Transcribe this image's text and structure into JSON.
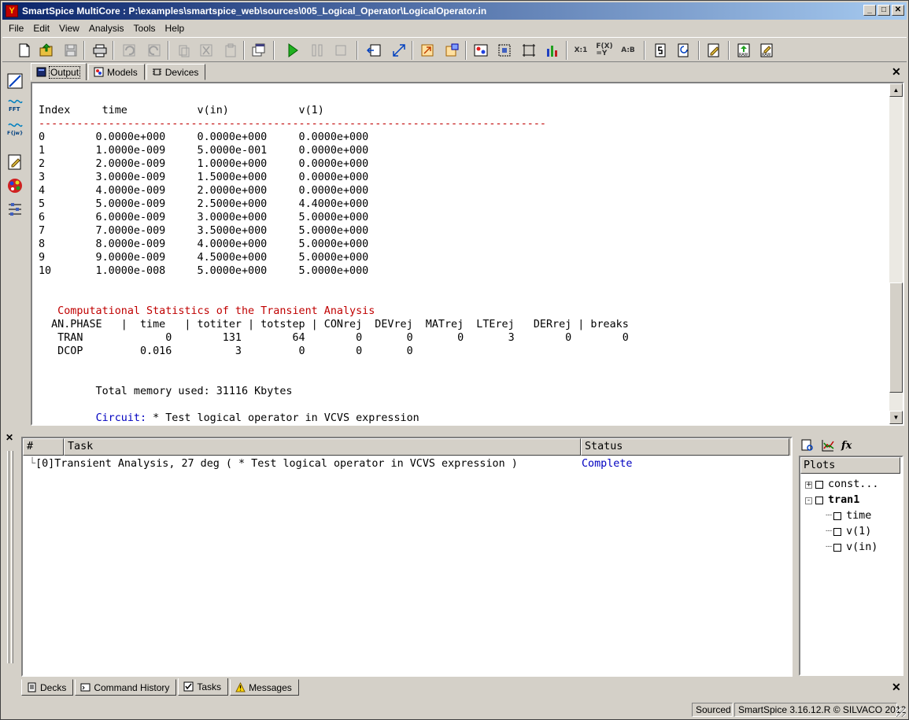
{
  "window": {
    "title": "SmartSpice MultiCore : P:\\examples\\smartspice_web\\sources\\005_Logical_Operator\\LogicalOperator.in",
    "app_icon_glyph": "Y"
  },
  "menu": [
    "File",
    "Edit",
    "View",
    "Analysis",
    "Tools",
    "Help"
  ],
  "toolbar": {
    "func_labels": {
      "x1": "X:1",
      "fx": "F(X)\n=Y",
      "ab": "A:B"
    }
  },
  "top_tabs": {
    "output": "Output",
    "models": "Models",
    "devices": "Devices"
  },
  "output": {
    "header": "Index     time           v(in)           v(1)",
    "separator": "--------------------------------------------------------------------------------",
    "rows": [
      "0        0.0000e+000     0.0000e+000     0.0000e+000",
      "1        1.0000e-009     5.0000e-001     0.0000e+000",
      "2        2.0000e-009     1.0000e+000     0.0000e+000",
      "3        3.0000e-009     1.5000e+000     0.0000e+000",
      "4        4.0000e-009     2.0000e+000     0.0000e+000",
      "5        5.0000e-009     2.5000e+000     4.4000e+000",
      "6        6.0000e-009     3.0000e+000     5.0000e+000",
      "7        7.0000e-009     3.5000e+000     5.0000e+000",
      "8        8.0000e-009     4.0000e+000     5.0000e+000",
      "9        9.0000e-009     4.5000e+000     5.0000e+000",
      "10       1.0000e-008     5.0000e+000     5.0000e+000"
    ],
    "stats_title": "   Computational Statistics of the Transient Analysis",
    "stats_header": "  AN.PHASE   |  time   | totiter | totstep | CONrej  DEVrej  MATrej  LTErej   DERrej | breaks",
    "stats_tran": "   TRAN             0        131        64        0       0       0       3        0        0",
    "stats_dcop": "   DCOP         0.016          3         0        0       0",
    "memory": "         Total memory used: 31116 Kbytes",
    "circuit_label": "Circuit:",
    "circuit_text": " * Test logical operator in VCVS expression"
  },
  "tasks": {
    "columns": [
      "#",
      "Task",
      "Status"
    ],
    "row_index": "[0]",
    "row_task": "Transient Analysis, 27 deg ( * Test logical operator in VCVS expression )",
    "row_status": "Complete"
  },
  "plots": {
    "header": "Plots",
    "fx_label": "fx",
    "items": [
      {
        "label": "const...",
        "level": 0,
        "expander": "+"
      },
      {
        "label": "tran1",
        "level": 0,
        "expander": "-"
      },
      {
        "label": "time",
        "level": 1
      },
      {
        "label": "v(1)",
        "level": 1
      },
      {
        "label": "v(in)",
        "level": 1
      }
    ]
  },
  "bottom_tabs": {
    "decks": "Decks",
    "history": "Command History",
    "tasks": "Tasks",
    "messages": "Messages"
  },
  "status": {
    "state": "Sourced",
    "version": "SmartSpice 3.16.12.R © SILVACO 2012"
  },
  "colors": {
    "titlebar_start": "#0a246a",
    "titlebar_end": "#a6caf0",
    "stats_red": "#c00000",
    "link_blue": "#0000c0"
  }
}
